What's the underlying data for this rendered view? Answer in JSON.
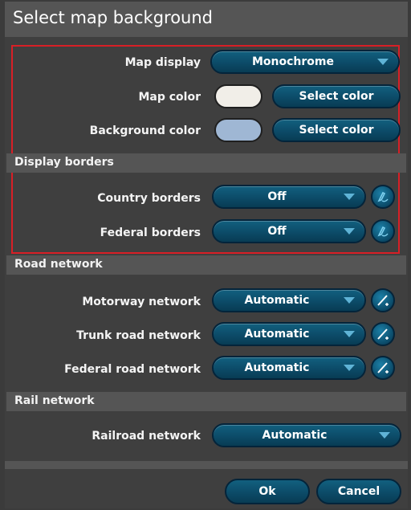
{
  "title": "Select map background",
  "map": {
    "display_label": "Map display",
    "display_value": "Monochrome",
    "color_label": "Map color",
    "color_swatch": "#f1eee8",
    "color_button": "Select color",
    "bg_label": "Background color",
    "bg_swatch": "#9fb7d4",
    "bg_button": "Select color"
  },
  "borders": {
    "section": "Display borders",
    "country_label": "Country borders",
    "country_value": "Off",
    "federal_label": "Federal borders",
    "federal_value": "Off"
  },
  "road": {
    "section": "Road network",
    "motorway_label": "Motorway network",
    "motorway_value": "Automatic",
    "trunk_label": "Trunk road network",
    "trunk_value": "Automatic",
    "federal_label": "Federal road network",
    "federal_value": "Automatic"
  },
  "rail": {
    "section": "Rail network",
    "railroad_label": "Railroad network",
    "railroad_value": "Automatic"
  },
  "footer": {
    "ok": "Ok",
    "cancel": "Cancel"
  },
  "colors": {
    "highlight": "#d81f26",
    "button": "#0c4b68",
    "caret": "#5fb3d6"
  },
  "icons": {
    "border_edit": "pen-stroke-icon",
    "road_edit": "pen-slash-icon"
  }
}
